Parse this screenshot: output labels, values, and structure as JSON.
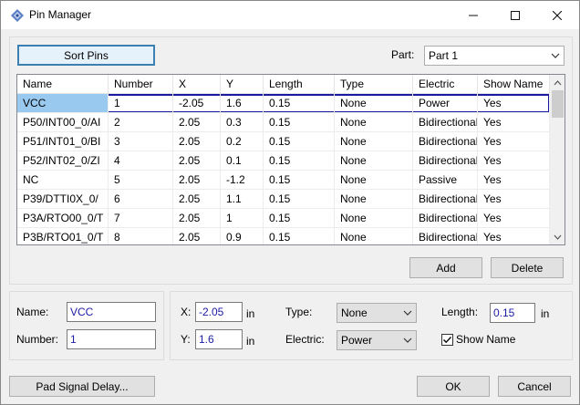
{
  "window": {
    "title": "Pin Manager",
    "minimize_glyph": "—",
    "maximize_glyph": "☐",
    "close_glyph": "✕"
  },
  "toolbar": {
    "sort_label": "Sort Pins",
    "part_label": "Part:",
    "part_value": "Part 1"
  },
  "table": {
    "columns": [
      "Name",
      "Number",
      "X",
      "Y",
      "Length",
      "Type",
      "Electric",
      "Show Name"
    ],
    "rows": [
      [
        "VCC",
        "1",
        "-2.05",
        "1.6",
        "0.15",
        "None",
        "Power",
        "Yes"
      ],
      [
        "P50/INT00_0/AI",
        "2",
        "2.05",
        "0.3",
        "0.15",
        "None",
        "Bidirectional",
        "Yes"
      ],
      [
        "P51/INT01_0/BI",
        "3",
        "2.05",
        "0.2",
        "0.15",
        "None",
        "Bidirectional",
        "Yes"
      ],
      [
        "P52/INT02_0/ZI",
        "4",
        "2.05",
        "0.1",
        "0.15",
        "None",
        "Bidirectional",
        "Yes"
      ],
      [
        "NC",
        "5",
        "2.05",
        "-1.2",
        "0.15",
        "None",
        "Passive",
        "Yes"
      ],
      [
        "P39/DTTI0X_0/",
        "6",
        "2.05",
        "1.1",
        "0.15",
        "None",
        "Bidirectional",
        "Yes"
      ],
      [
        "P3A/RTO00_0/T",
        "7",
        "2.05",
        "1",
        "0.15",
        "None",
        "Bidirectional",
        "Yes"
      ],
      [
        "P3B/RTO01_0/T",
        "8",
        "2.05",
        "0.9",
        "0.15",
        "None",
        "Bidirectional",
        "Yes"
      ]
    ],
    "selected_row": 0
  },
  "actions": {
    "add_label": "Add",
    "delete_label": "Delete"
  },
  "detail": {
    "name_label": "Name:",
    "name_value": "VCC",
    "number_label": "Number:",
    "number_value": "1",
    "x_label": "X:",
    "x_value": "-2.05",
    "x_unit": "in",
    "y_label": "Y:",
    "y_value": "1.6",
    "y_unit": "in",
    "type_label": "Type:",
    "type_value": "None",
    "electric_label": "Electric:",
    "electric_value": "Power",
    "length_label": "Length:",
    "length_value": "0.15",
    "length_unit": "in",
    "show_name_label": "Show Name",
    "show_name_checked": true
  },
  "footer": {
    "pad_delay_label": "Pad Signal Delay...",
    "ok_label": "OK",
    "cancel_label": "Cancel"
  },
  "colors": {
    "accent": "#3c7fb1",
    "selection": "#99c9ef",
    "input_text": "#1b1ba6"
  }
}
